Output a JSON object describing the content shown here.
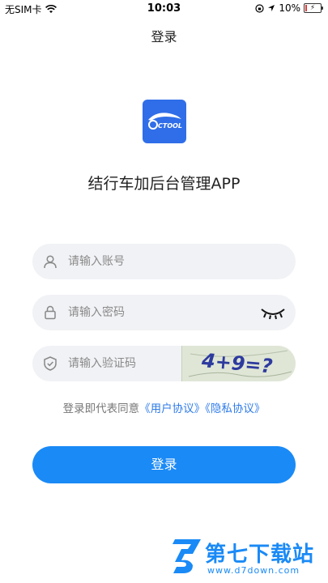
{
  "status_bar": {
    "carrier": "无SIM卡",
    "time": "10:03",
    "battery_percent": "10%",
    "battery_level": 0.1
  },
  "header": {
    "title": "登录"
  },
  "app": {
    "logo_text": "CTOOL",
    "name": "结行车加后台管理APP"
  },
  "form": {
    "account_placeholder": "请输入账号",
    "password_placeholder": "请输入密码",
    "captcha_placeholder": "请输入验证码",
    "captcha_text": "4+9=?"
  },
  "agreement": {
    "prefix": "登录即代表同意",
    "user_agreement": "《用户协议》",
    "privacy_policy": "《隐私协议》"
  },
  "login_button": "登录",
  "watermark": {
    "title": "第七下载站",
    "url": "www.d7down.com"
  },
  "colors": {
    "primary": "#1a8af6",
    "logo_bg": "#2f6ee8",
    "link": "#2f7be8",
    "field_bg": "#f1f2f5"
  }
}
